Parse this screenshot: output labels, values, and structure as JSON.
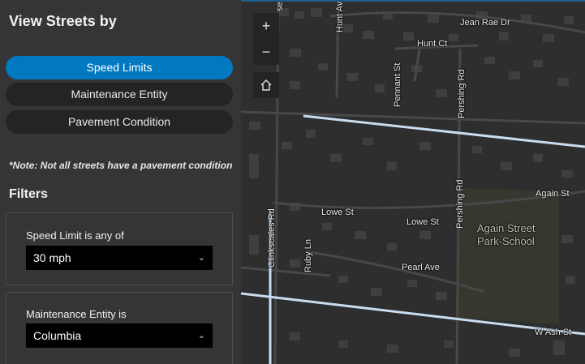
{
  "panel": {
    "title": "View Streets by",
    "view_options": [
      "Speed Limits",
      "Maintenance Entity",
      "Pavement Condition"
    ],
    "active_view": "Speed Limits",
    "note": "*Note: Not all streets have a pavement condition",
    "filters_title": "Filters",
    "filters": [
      {
        "label": "Speed Limit is any of",
        "value": "30 mph"
      },
      {
        "label": "Maintenance Entity is",
        "value": "Columbia"
      }
    ]
  },
  "map": {
    "zoom_in": "+",
    "zoom_out": "−",
    "accent_color": "#c9ddf0",
    "street_labels": {
      "jean_rae": "Jean Rae Dr",
      "hunt_ct": "Hunt Ct",
      "hunt_ave": "Hunt Av",
      "pennant": "Pennant St",
      "pershing_top": "Pershing Rd",
      "pershing_mid": "Pershing Rd",
      "again_st": "Again St",
      "lowe_west": "Lowe St",
      "lowe_east": "Lowe St",
      "clinkscales": "Clinkscales Rd",
      "ruby": "Ruby Ln",
      "pearl": "Pearl Ave",
      "w_ash": "W Ash St",
      "top_cut": "se"
    },
    "school_label_1": "Again Street",
    "school_label_2": "Park-School"
  }
}
